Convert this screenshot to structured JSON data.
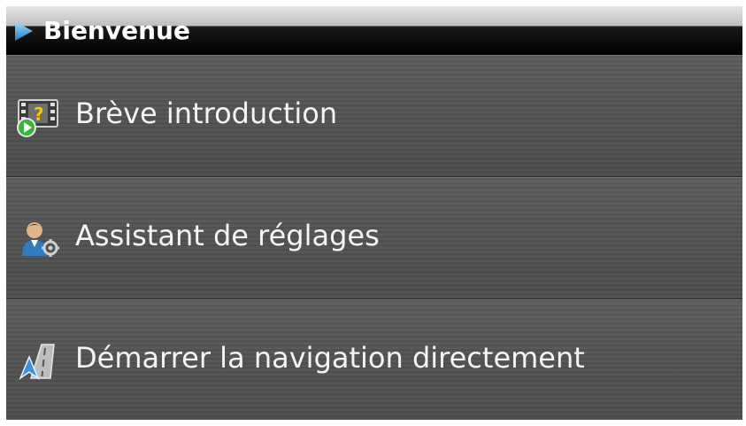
{
  "header": {
    "title": "Bienvenue",
    "arrow_icon": "play-arrow-icon"
  },
  "menu": {
    "items": [
      {
        "label": "Brève introduction",
        "icon": "film-question-icon"
      },
      {
        "label": "Assistant de réglages",
        "icon": "user-settings-icon"
      },
      {
        "label": "Démarrer la navigation directement",
        "icon": "navigation-road-icon"
      }
    ]
  },
  "colors": {
    "title_bar": "#000000",
    "arrow": "#3aa0e0",
    "menu_background": "#555555",
    "text": "#f4f4f4"
  }
}
